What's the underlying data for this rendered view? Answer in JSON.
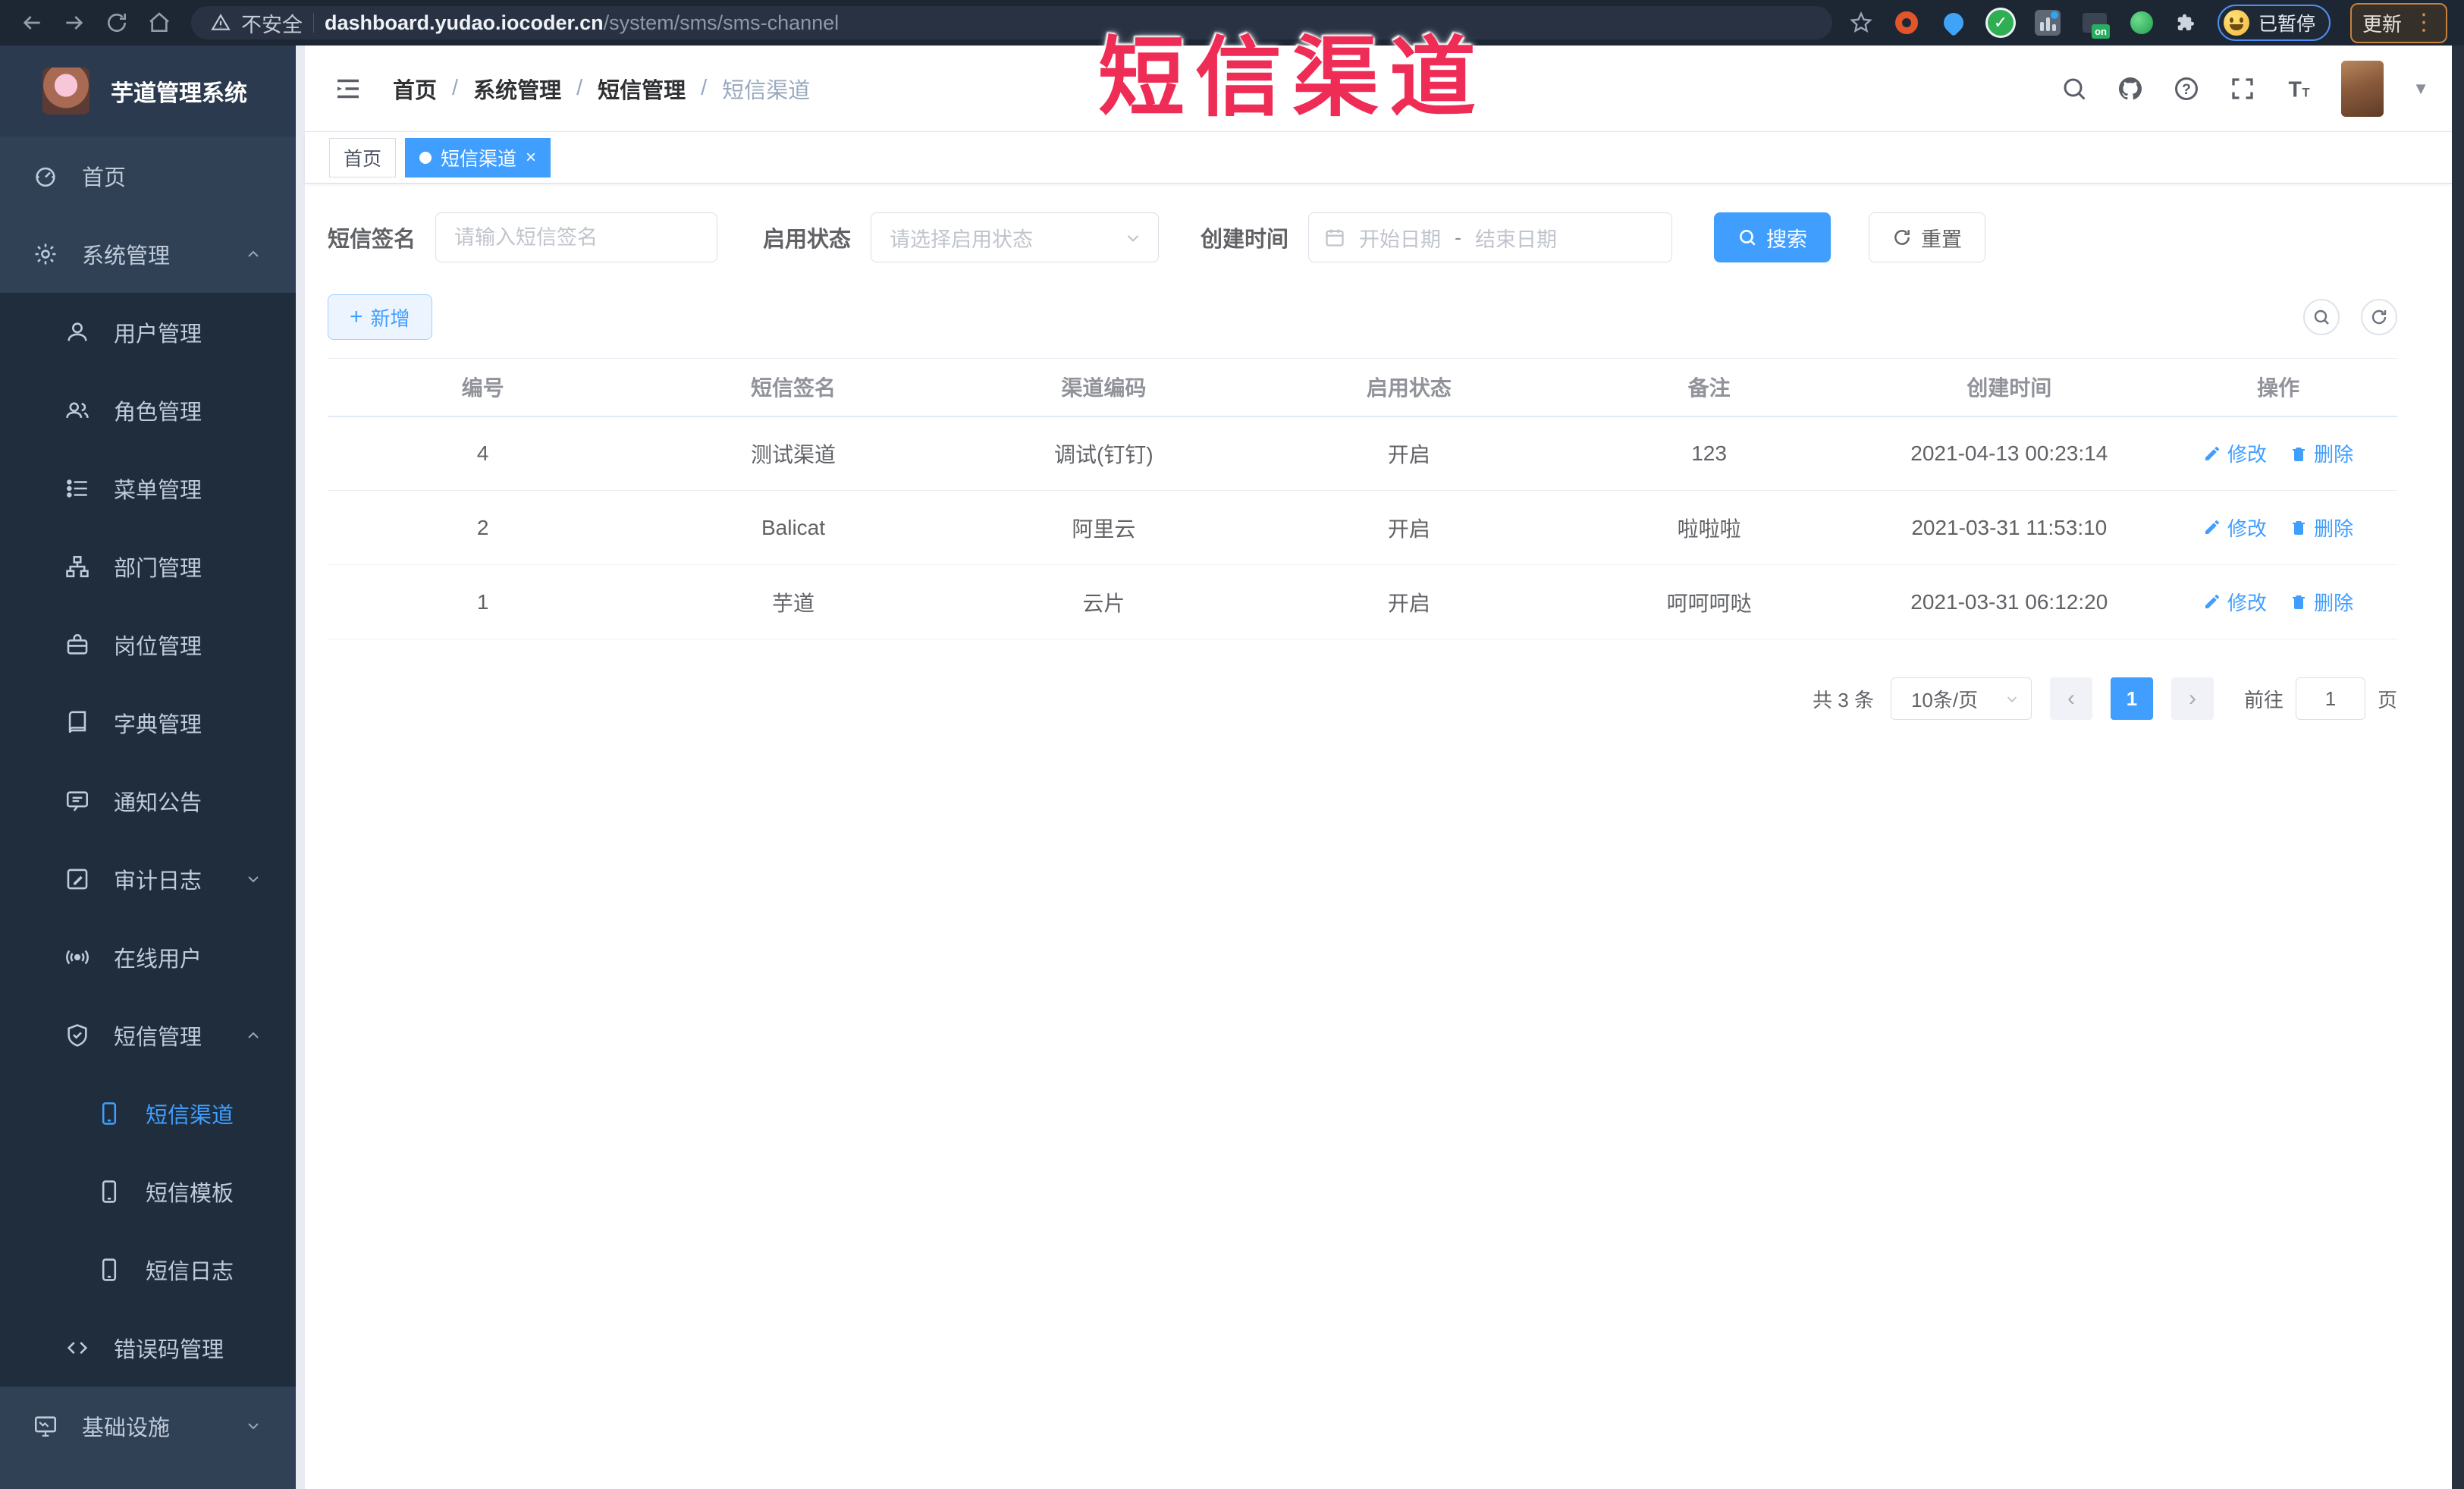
{
  "browser": {
    "security_label": "不安全",
    "url_host": "dashboard.yudao.iocoder.cn",
    "url_path": "/system/sms/sms-channel",
    "paused_badge": "已暂停",
    "update_button": "更新"
  },
  "overlay": {
    "text": "短信渠道",
    "color": "#ee2c55"
  },
  "sidebar": {
    "logo_title": "芋道管理系统",
    "items": [
      {
        "key": "home",
        "label": "首页",
        "icon": "gauge-icon",
        "level": 1
      },
      {
        "key": "system",
        "label": "系统管理",
        "icon": "gear-icon",
        "level": 1,
        "chevron": "up"
      },
      {
        "key": "users",
        "label": "用户管理",
        "icon": "user-icon",
        "level": 2
      },
      {
        "key": "roles",
        "label": "角色管理",
        "icon": "roles-icon",
        "level": 2
      },
      {
        "key": "menus",
        "label": "菜单管理",
        "icon": "menu-list-icon",
        "level": 2
      },
      {
        "key": "depts",
        "label": "部门管理",
        "icon": "org-tree-icon",
        "level": 2
      },
      {
        "key": "posts",
        "label": "岗位管理",
        "icon": "briefcase-icon",
        "level": 2
      },
      {
        "key": "dicts",
        "label": "字典管理",
        "icon": "book-icon",
        "level": 2
      },
      {
        "key": "notices",
        "label": "通知公告",
        "icon": "message-icon",
        "level": 2
      },
      {
        "key": "audit-logs",
        "label": "审计日志",
        "icon": "edit-log-icon",
        "level": 2,
        "chevron": "down"
      },
      {
        "key": "online-users",
        "label": "在线用户",
        "icon": "signal-icon",
        "level": 2
      },
      {
        "key": "sms",
        "label": "短信管理",
        "icon": "shield-icon",
        "level": 2,
        "chevron": "up"
      },
      {
        "key": "sms-channel",
        "label": "短信渠道",
        "icon": "phone-icon",
        "level": 3,
        "active": true
      },
      {
        "key": "sms-template",
        "label": "短信模板",
        "icon": "phone-icon",
        "level": 3
      },
      {
        "key": "sms-log",
        "label": "短信日志",
        "icon": "phone-icon",
        "level": 3
      },
      {
        "key": "error-codes",
        "label": "错误码管理",
        "icon": "code-icon",
        "level": 2
      },
      {
        "key": "infrastructure",
        "label": "基础设施",
        "icon": "monitor-icon",
        "level": 1,
        "chevron": "down"
      }
    ]
  },
  "breadcrumb": [
    "首页",
    "系统管理",
    "短信管理",
    "短信渠道"
  ],
  "tabs": [
    {
      "label": "首页",
      "active": false,
      "closable": false
    },
    {
      "label": "短信渠道",
      "active": true,
      "closable": true
    }
  ],
  "filters": {
    "sign_label": "短信签名",
    "sign_placeholder": "请输入短信签名",
    "status_label": "启用状态",
    "status_placeholder": "请选择启用状态",
    "time_label": "创建时间",
    "start_placeholder": "开始日期",
    "range_separator": "-",
    "end_placeholder": "结束日期",
    "search_button": "搜索",
    "reset_button": "重置"
  },
  "toolbar": {
    "add_button": "新增"
  },
  "table": {
    "columns": [
      "编号",
      "短信签名",
      "渠道编码",
      "启用状态",
      "备注",
      "创建时间",
      "操作"
    ],
    "edit_label": "修改",
    "delete_label": "删除",
    "rows": [
      {
        "id": "4",
        "sign": "测试渠道",
        "code": "调试(钉钉)",
        "status": "开启",
        "remark": "123",
        "created": "2021-04-13 00:23:14"
      },
      {
        "id": "2",
        "sign": "Balicat",
        "code": "阿里云",
        "status": "开启",
        "remark": "啦啦啦",
        "created": "2021-03-31 11:53:10"
      },
      {
        "id": "1",
        "sign": "芋道",
        "code": "云片",
        "status": "开启",
        "remark": "呵呵呵哒",
        "created": "2021-03-31 06:12:20"
      }
    ]
  },
  "pagination": {
    "total_text": "共 3 条",
    "page_size": "10条/页",
    "current_page": "1",
    "goto_label": "前往",
    "goto_value": "1",
    "page_unit": "页"
  },
  "colors": {
    "accent": "#409eff",
    "sidebar_bg": "#304156",
    "submenu_bg": "#1f2d3d",
    "annotation": "#ee2c55"
  }
}
